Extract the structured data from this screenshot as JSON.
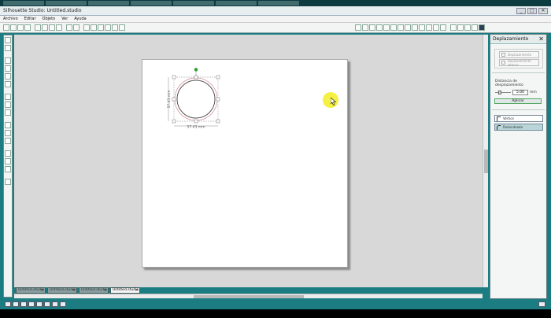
{
  "app": {
    "title": "Silhouette Studio: Untitled.studio",
    "window_buttons": [
      "_",
      "□",
      "✕"
    ]
  },
  "menu": [
    "Archivo",
    "Editar",
    "Objeto",
    "Ver",
    "Ayuda"
  ],
  "design": {
    "width_dim": "57.43 mm",
    "height_dim": "57.43 mm",
    "handle_color": "#2a9d2a",
    "circle_color": "#d9a0a8"
  },
  "tabs": [
    {
      "label": "Untitled.studio",
      "active": false
    },
    {
      "label": "Untitled.studio",
      "active": false
    },
    {
      "label": "Untitled.studio",
      "active": false
    },
    {
      "label": "Untitled.studio",
      "active": true
    }
  ],
  "panel": {
    "title": "Deplazamiento",
    "close": "✕",
    "options": [
      "Deplazamiento",
      "Deplazamiento interno"
    ],
    "distance_label": "Distancia de desplazamiento",
    "distance_value": "5.00",
    "unit": "mm",
    "apply": "Aplicar",
    "modes": [
      {
        "label": "Vértice",
        "selected": false
      },
      {
        "label": "Redondeado",
        "selected": true
      }
    ]
  },
  "colors": {
    "frame": "#1b7d82",
    "workspace": "#d8d8d8",
    "cursor_highlight": "#f4ee2e"
  }
}
